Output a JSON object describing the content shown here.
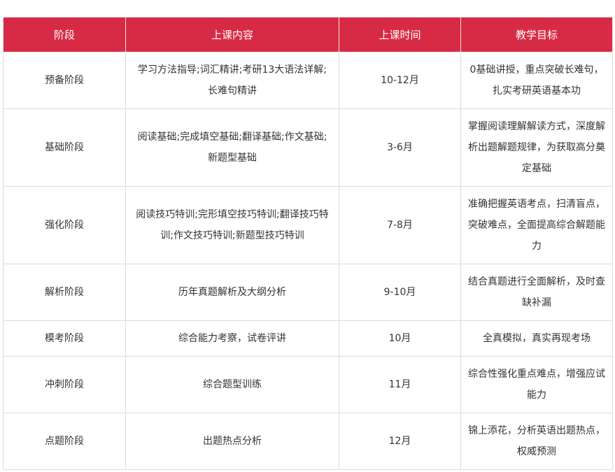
{
  "table": {
    "headers": [
      "阶段",
      "上课内容",
      "上课时间",
      "教学目标"
    ],
    "rows": [
      {
        "stage": "预备阶段",
        "content": "学习方法指导;词汇精讲;考研13大语法详解;长难句精讲",
        "time": "10-12月",
        "goal": "0基础讲授，重点突破长难句，扎实考研英语基本功"
      },
      {
        "stage": "基础阶段",
        "content": "阅读基础;完成填空基础;翻译基础;作文基础;新题型基础",
        "time": "3-6月",
        "goal": "掌握阅读理解解读方式，深度解析出题解题规律，为获取高分奠定基础"
      },
      {
        "stage": "强化阶段",
        "content": "阅读技巧特训;完形填空技巧特训;翻译技巧特训;作文技巧特训;新题型技巧特训",
        "time": "7-8月",
        "goal": "准确把握英语考点，扫清盲点，突破难点，全面提高综合解题能力"
      },
      {
        "stage": "解析阶段",
        "content": "历年真题解析及大纲分析",
        "time": "9-10月",
        "goal": "结合真题进行全面解析，及时查缺补漏"
      },
      {
        "stage": "模考阶段",
        "content": "综合能力考察，试卷评讲",
        "time": "10月",
        "goal": "全真模拟，真实再现考场"
      },
      {
        "stage": "冲刺阶段",
        "content": "综合题型训练",
        "time": "11月",
        "goal": "综合性强化重点难点，增强应试能力"
      },
      {
        "stage": "点题阶段",
        "content": "出题热点分析",
        "time": "12月",
        "goal": "锦上添花，分析英语出题热点，权威预测"
      }
    ]
  },
  "colors": {
    "header_bg": "#d72b45",
    "header_text": "#ffffff",
    "border": "#dcdcdc",
    "body_text": "#333333"
  }
}
